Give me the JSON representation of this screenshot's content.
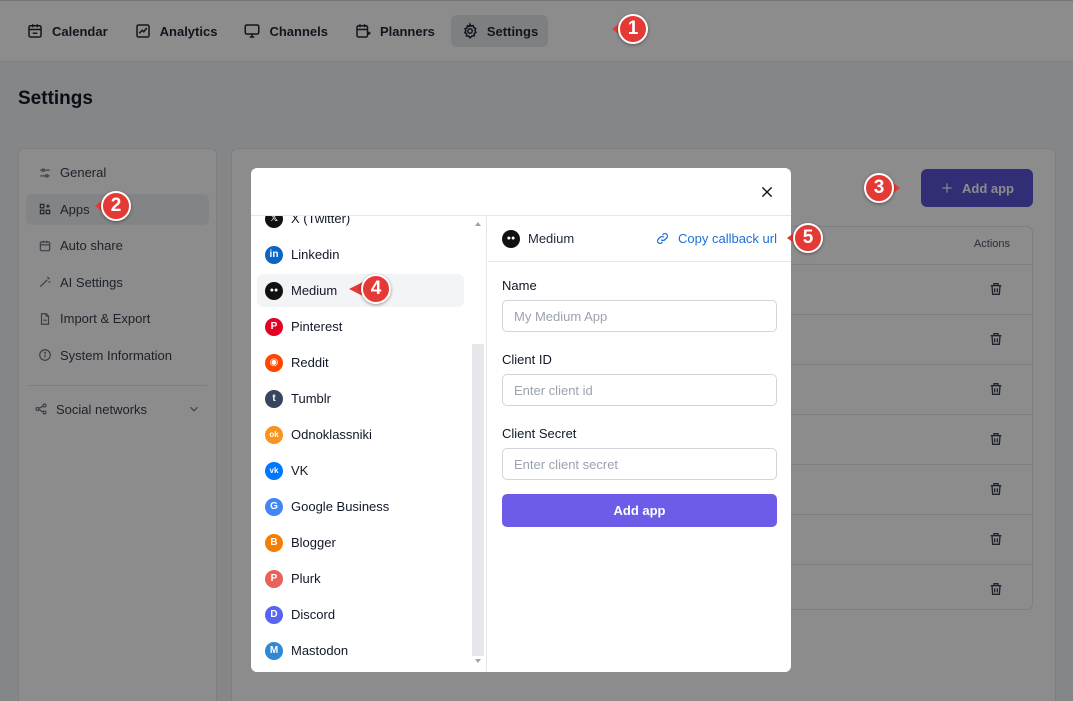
{
  "nav": {
    "items": [
      {
        "label": "Calendar",
        "icon": "calendar-icon"
      },
      {
        "label": "Analytics",
        "icon": "analytics-icon"
      },
      {
        "label": "Channels",
        "icon": "monitor-icon"
      },
      {
        "label": "Planners",
        "icon": "planner-icon"
      },
      {
        "label": "Settings",
        "icon": "gear-icon",
        "active": true
      }
    ]
  },
  "page": {
    "title": "Settings"
  },
  "sidebar": {
    "items": [
      {
        "label": "General"
      },
      {
        "label": "Apps",
        "active": true
      },
      {
        "label": "Auto share"
      },
      {
        "label": "AI Settings"
      },
      {
        "label": "Import & Export"
      },
      {
        "label": "System Information"
      }
    ],
    "social_networks_label": "Social networks"
  },
  "main": {
    "add_app_label": "Add app",
    "table_actions_header": "Actions"
  },
  "modal": {
    "networks": [
      {
        "label": "X (Twitter)",
        "color": "#111111",
        "glyph": "𝕏"
      },
      {
        "label": "Linkedin",
        "color": "#0a66c2",
        "glyph": "in"
      },
      {
        "label": "Medium",
        "color": "#111111",
        "glyph": "●●",
        "active": true
      },
      {
        "label": "Pinterest",
        "color": "#e60023",
        "glyph": "P"
      },
      {
        "label": "Reddit",
        "color": "#ff4500",
        "glyph": "◉"
      },
      {
        "label": "Tumblr",
        "color": "#36465d",
        "glyph": "t"
      },
      {
        "label": "Odnoklassniki",
        "color": "#f7931e",
        "glyph": "ok"
      },
      {
        "label": "VK",
        "color": "#0077ff",
        "glyph": "vk"
      },
      {
        "label": "Google Business",
        "color": "#4285f4",
        "glyph": "G"
      },
      {
        "label": "Blogger",
        "color": "#f57d00",
        "glyph": "B"
      },
      {
        "label": "Plurk",
        "color": "#e8625a",
        "glyph": "P"
      },
      {
        "label": "Discord",
        "color": "#5865f2",
        "glyph": "D"
      },
      {
        "label": "Mastodon",
        "color": "#3088d4",
        "glyph": "M"
      }
    ],
    "selected_network": "Medium",
    "copy_callback_label": "Copy callback url",
    "form": {
      "name_label": "Name",
      "name_placeholder": "My Medium App",
      "client_id_label": "Client ID",
      "client_id_placeholder": "Enter client id",
      "client_secret_label": "Client Secret",
      "client_secret_placeholder": "Enter client secret",
      "submit_label": "Add app"
    }
  },
  "markers": [
    "1",
    "2",
    "3",
    "4",
    "5"
  ],
  "colors": {
    "accent": "#6c5ce7",
    "marker": "#e53935",
    "link": "#1d6fd8"
  }
}
